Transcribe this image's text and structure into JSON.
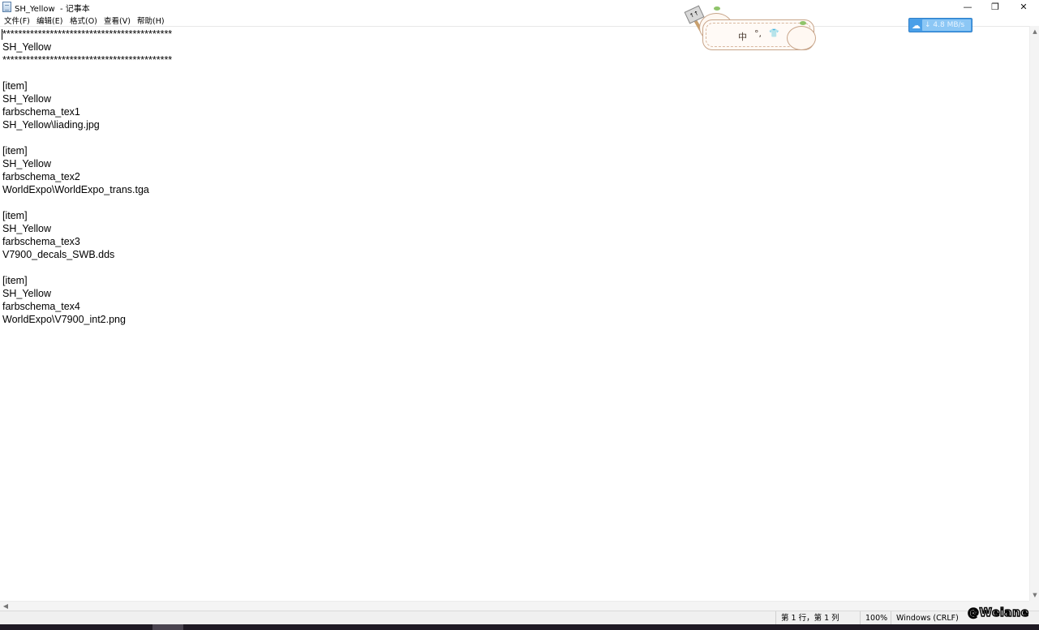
{
  "window": {
    "title": "SH_Yellow  - 记事本",
    "minimize": "—",
    "maximize": "❐",
    "close": "✕"
  },
  "menu": [
    "文件(F)",
    "编辑(E)",
    "格式(O)",
    "查看(V)",
    "帮助(H)"
  ],
  "document": {
    "lines": [
      "*******************************************",
      "SH_Yellow",
      "*******************************************",
      "",
      "[item]",
      "SH_Yellow",
      "farbschema_tex1",
      "SH_Yellow\\liading.jpg",
      "",
      "[item]",
      "SH_Yellow",
      "farbschema_tex2",
      "WorldExpo\\WorldExpo_trans.tga",
      "",
      "[item]",
      "SH_Yellow",
      "farbschema_tex3",
      "V7900_decals_SWB.dds",
      "",
      "[item]",
      "SH_Yellow",
      "farbschema_tex4",
      "WorldExpo\\V7900_int2.png"
    ]
  },
  "status": {
    "position": "第 1 行，第 1 列",
    "zoom": "100%",
    "encoding": "Windows (CRLF)"
  },
  "ime": {
    "mode": "中",
    "punct": "°,",
    "shirt": "👕"
  },
  "netspeed": {
    "value": "4.8 MB/s"
  },
  "watermark": "@Weiane",
  "colors": {
    "netspeed_bg": "#4a9fe8",
    "ime_border": "#c8a58a",
    "taskbar": "#1f1a24"
  }
}
